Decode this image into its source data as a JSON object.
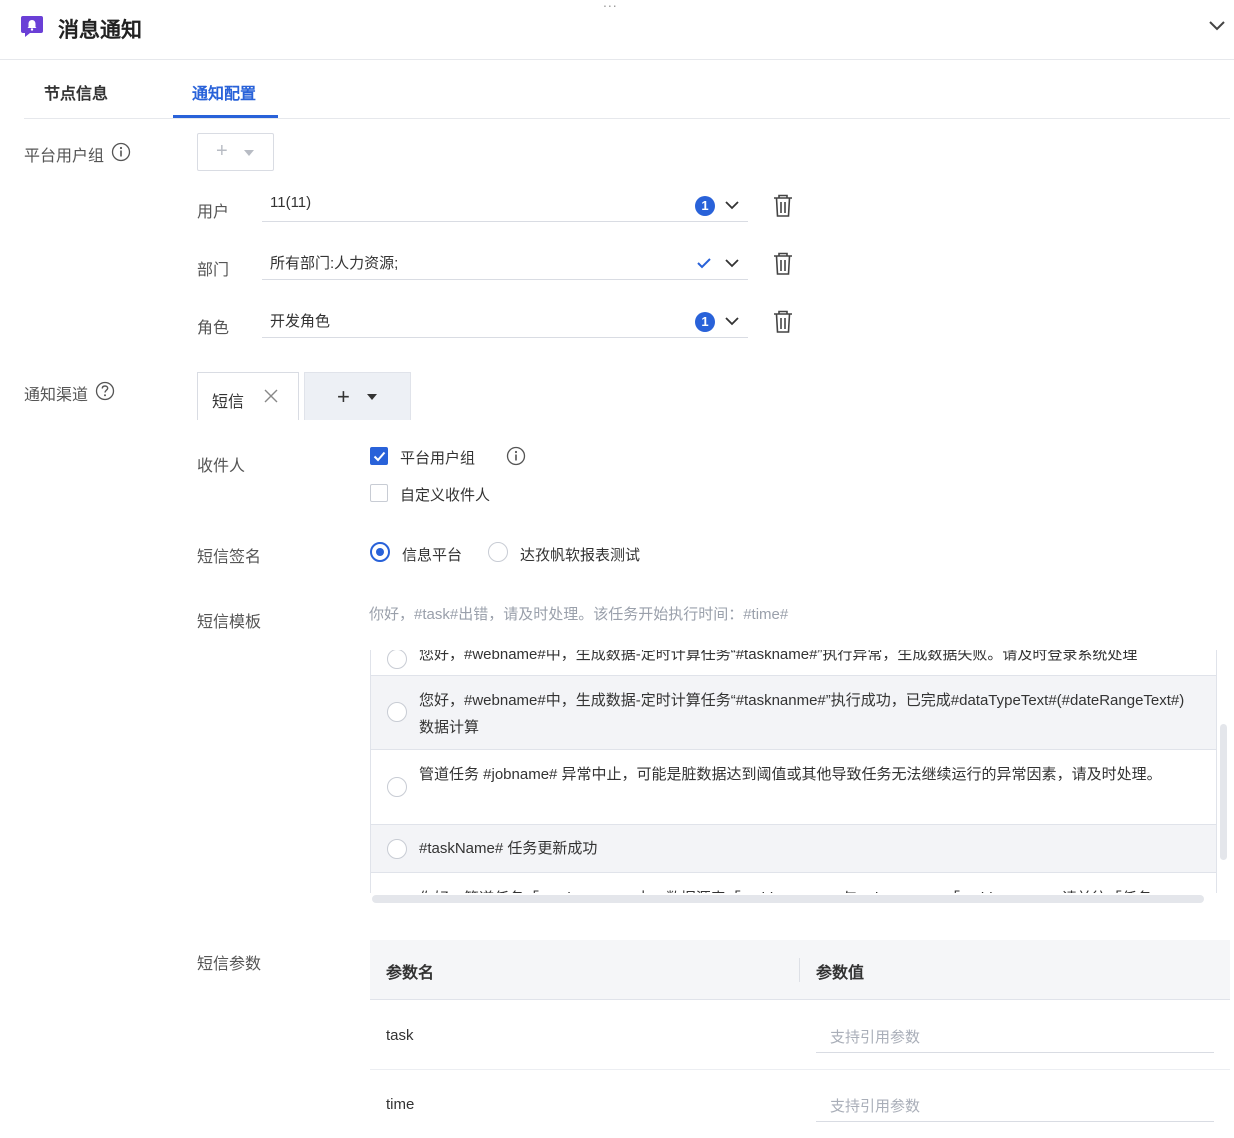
{
  "header": {
    "drag_handle": "...",
    "title": "消息通知"
  },
  "tabs": [
    {
      "label": "节点信息",
      "active": false
    },
    {
      "label": "通知配置",
      "active": true
    }
  ],
  "platform_user_group": {
    "label": "平台用户组",
    "add_plus": "+",
    "rows": [
      {
        "label": "用户",
        "value": "11(11)",
        "badge": "1"
      },
      {
        "label": "部门",
        "value": "所有部门:人力资源;",
        "badge": null
      },
      {
        "label": "角色",
        "value": "开发角色",
        "badge": "1"
      }
    ]
  },
  "channel": {
    "label": "通知渠道",
    "tab_label": "短信",
    "add_plus": "+"
  },
  "recipients": {
    "label": "收件人",
    "options": [
      {
        "label": "平台用户组",
        "checked": true
      },
      {
        "label": "自定义收件人",
        "checked": false
      }
    ]
  },
  "signature": {
    "label": "短信签名",
    "options": [
      {
        "label": "信息平台",
        "selected": true
      },
      {
        "label": "达孜帆软报表测试",
        "selected": false
      }
    ]
  },
  "template": {
    "label": "短信模板",
    "current": "你好，#task#出错，请及时处理。该任务开始执行时间：#time#",
    "items": [
      {
        "text": "您好，#webname#中，生成数据-定时计算任务“#taskname#”执行异常，生成数据失败。请及时登录系统处理",
        "selected": false
      },
      {
        "text": "您好，#webname#中，生成数据-定时计算任务“#tasknanme#”执行成功，已完成#dataTypeText#(#dateRangeText#)数据计算",
        "selected": true
      },
      {
        "text": "管道任务 #jobname# 异常中止，可能是脏数据达到阈值或其他导致任务无法继续运行的异常因素，请及时处理。",
        "selected": false
      },
      {
        "text": "#taskName# 任务更新成功",
        "selected": true
      },
      {
        "text": "你好，管道任务「#taskname#」中，数据源表「#tablename#」与 #dataname#「#tablename#」请前往「任务",
        "selected": false
      }
    ]
  },
  "params": {
    "label": "短信参数",
    "col_name": "参数名",
    "col_value": "参数值",
    "rows": [
      {
        "name": "task",
        "placeholder": "支持引用参数"
      },
      {
        "name": "time",
        "placeholder": "支持引用参数"
      }
    ]
  },
  "colors": {
    "accent": "#2962d9",
    "text": "#333333",
    "muted": "#9aa0ab",
    "border": "#d9dce3"
  },
  "icons": [
    "bell-icon",
    "chevron-down-icon",
    "info-icon",
    "help-icon",
    "trash-icon",
    "check-icon",
    "close-icon",
    "plus-icon",
    "caret-down-icon"
  ]
}
